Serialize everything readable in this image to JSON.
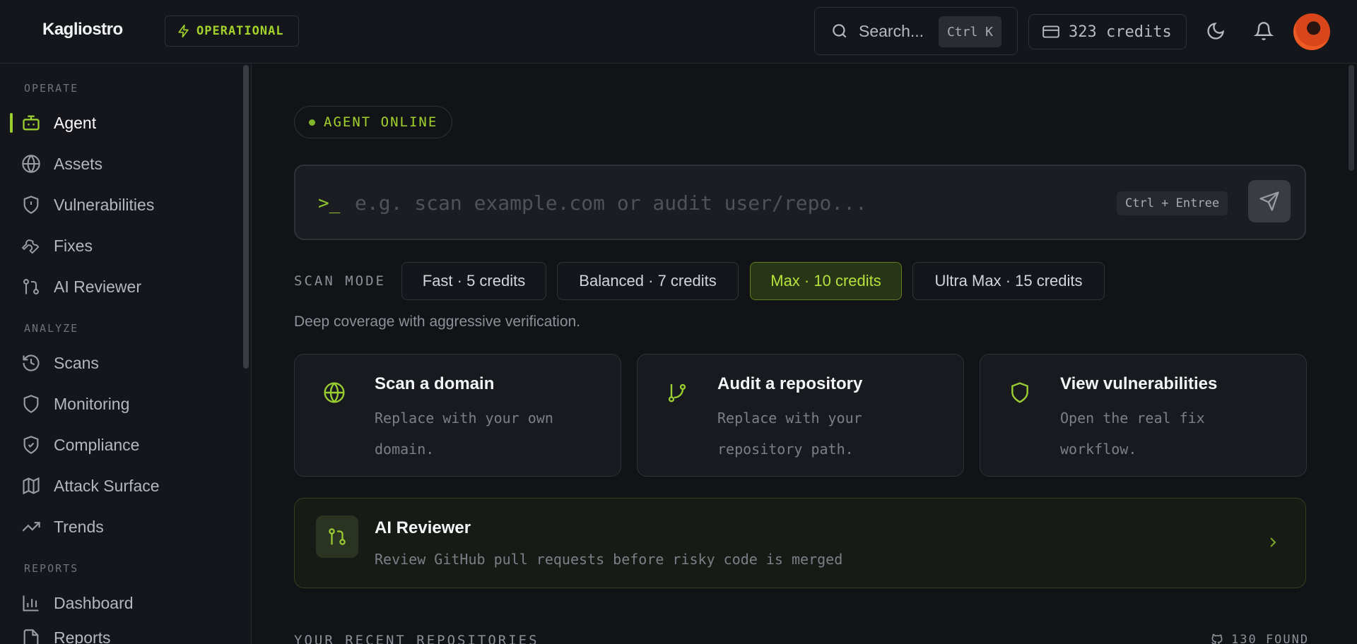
{
  "header": {
    "logo_text": "Kagliostro",
    "status": "OPERATIONAL",
    "search_placeholder": "Search...",
    "search_shortcut": "Ctrl K",
    "credits": "323 credits"
  },
  "sidebar": {
    "sections": [
      {
        "title": "OPERATE",
        "items": [
          {
            "label": "Agent",
            "icon": "robot-icon",
            "active": true
          },
          {
            "label": "Assets",
            "icon": "globe-icon"
          },
          {
            "label": "Vulnerabilities",
            "icon": "shield-alert-icon"
          },
          {
            "label": "Fixes",
            "icon": "wrench-icon"
          },
          {
            "label": "AI Reviewer",
            "icon": "git-pull-request-icon"
          }
        ]
      },
      {
        "title": "ANALYZE",
        "items": [
          {
            "label": "Scans",
            "icon": "history-icon"
          },
          {
            "label": "Monitoring",
            "icon": "shield-icon"
          },
          {
            "label": "Compliance",
            "icon": "shield-check-icon"
          },
          {
            "label": "Attack Surface",
            "icon": "map-icon"
          },
          {
            "label": "Trends",
            "icon": "trending-up-icon"
          }
        ]
      },
      {
        "title": "REPORTS",
        "items": [
          {
            "label": "Dashboard",
            "icon": "bar-chart-icon"
          },
          {
            "label": "Reports",
            "icon": "file-icon"
          }
        ]
      }
    ]
  },
  "main": {
    "agent_status": "AGENT ONLINE",
    "prompt": {
      "placeholder": "e.g. scan example.com or audit user/repo...",
      "shortcut": "Ctrl + Entree"
    },
    "scan_mode": {
      "label": "SCAN MODE",
      "options": [
        {
          "label": "Fast · 5 credits"
        },
        {
          "label": "Balanced · 7 credits"
        },
        {
          "label": "Max · 10 credits",
          "selected": true
        },
        {
          "label": "Ultra Max · 15 credits"
        }
      ],
      "description": "Deep coverage with aggressive verification."
    },
    "cards": [
      {
        "title": "Scan a domain",
        "desc": "Replace with your own domain.",
        "icon": "globe-icon"
      },
      {
        "title": "Audit a repository",
        "desc": "Replace with your repository path.",
        "icon": "git-branch-icon"
      },
      {
        "title": "View vulnerabilities",
        "desc": "Open the real fix workflow.",
        "icon": "shield-icon"
      }
    ],
    "reviewer": {
      "title": "AI Reviewer",
      "desc": "Review GitHub pull requests before risky code is merged"
    },
    "recent": {
      "title": "YOUR RECENT REPOSITORIES",
      "found": "130 FOUND"
    }
  },
  "colors": {
    "accent": "#9acd32",
    "background": "#121317",
    "panel": "#14161b"
  }
}
